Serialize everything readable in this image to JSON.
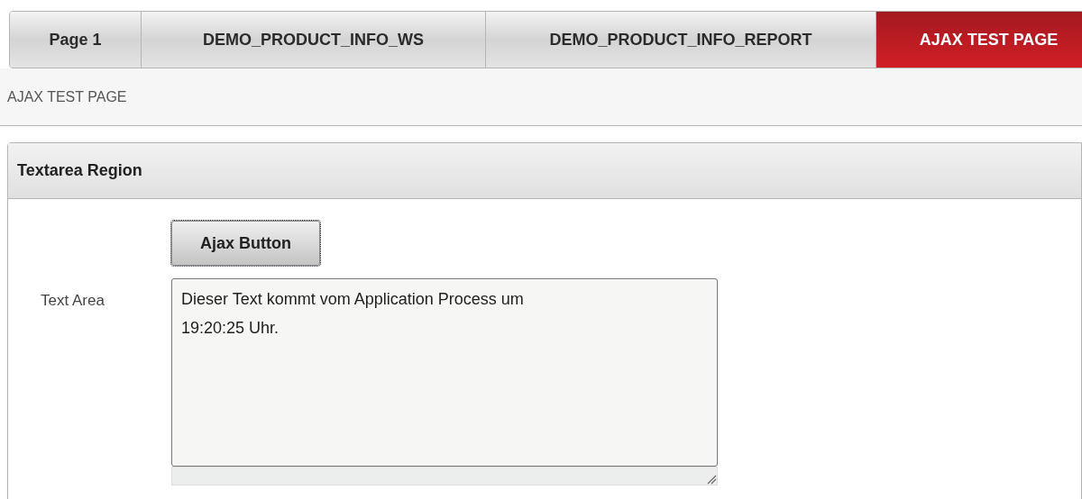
{
  "tabs": [
    {
      "label": "Page 1",
      "selected": false
    },
    {
      "label": "DEMO_PRODUCT_INFO_WS",
      "selected": false
    },
    {
      "label": "DEMO_PRODUCT_INFO_REPORT",
      "selected": false
    },
    {
      "label": "AJAX TEST PAGE",
      "selected": true
    }
  ],
  "breadcrumb": "AJAX TEST PAGE",
  "region": {
    "title": "Textarea Region",
    "button": "Ajax Button",
    "field": {
      "label": "Text Area",
      "value": "Dieser Text kommt vom Application Process um\n19:20:25 Uhr."
    }
  }
}
